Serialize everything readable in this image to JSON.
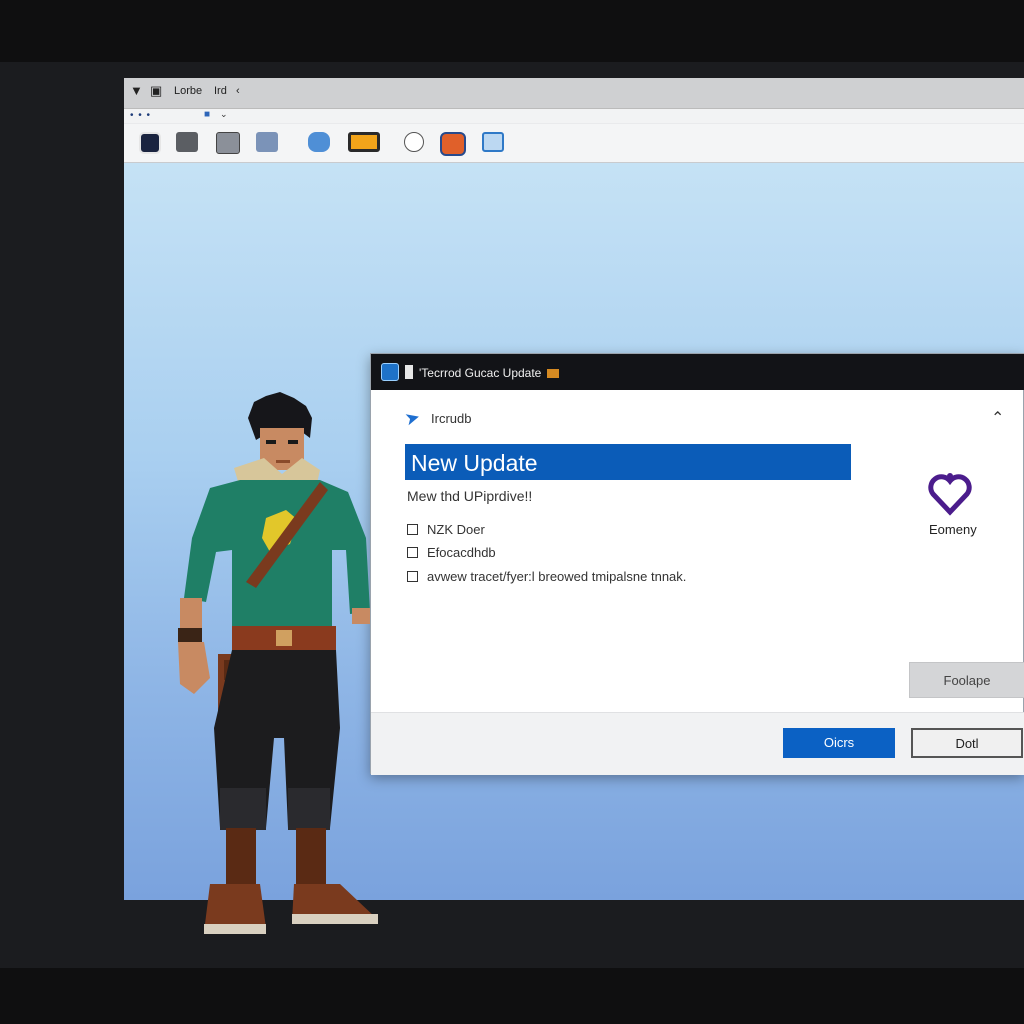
{
  "window": {
    "title_left": "Lorbe",
    "title_right": "Ird",
    "tab_dots": "• • •",
    "toolbar_icons": [
      "app-icon",
      "printer-icon",
      "copy-icon",
      "paste-icon",
      "monitor-icon",
      "folder-icon",
      "bell-icon",
      "stop-icon",
      "window-icon"
    ]
  },
  "dialog": {
    "title": "'Tecrrod Gucac  Update",
    "brand": "Ircrudb",
    "heading": "New Update",
    "subtext": "Mew thd UPiprdive!!",
    "options": [
      "NZK Doer",
      "Efocacdhdb",
      "avwew tracet/fyer:l breowed tmipalsne tnnak."
    ],
    "side_label": "Eomeny",
    "secondary_button": "Foolape",
    "primary_button": "Oicrs",
    "default_button": "Dotl"
  },
  "colors": {
    "accent": "#0b5cb8",
    "dialog_titlebar": "#121317",
    "desktop_top": "#c5e2f5",
    "desktop_bottom": "#7aa2dd"
  }
}
